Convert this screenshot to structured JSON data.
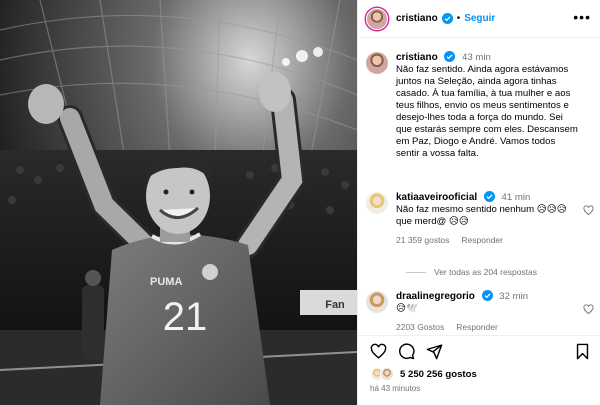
{
  "header": {
    "username": "cristiano",
    "separator": "•",
    "follow_label": "Seguir",
    "more_label": "•••"
  },
  "caption": {
    "username": "cristiano",
    "time": "43 min",
    "text": "Não faz sentido. Ainda agora estávamos juntos na Seleção, ainda agora tinhas casado. À tua família, à tua mulher e aos teus filhos, envio os meus sentimentos e desejo-lhes toda a força do mundo. Sei que estarás sempre com eles. Descansem em Paz, Diogo e André. Vamos todos sentir a vossa falta."
  },
  "comments": [
    {
      "username": "katiaaveirooficial",
      "time": "41 min",
      "text": "Não faz mesmo sentido nenhum 😥😥😥 que merd@ 😥😥",
      "likes": "21 359 gostos",
      "reply_label": "Responder"
    },
    {
      "username": "draalinegregorio",
      "time": "32 min",
      "text": "😥🕊️",
      "likes": "2203 Gostos",
      "reply_label": "Responder"
    }
  ],
  "view_replies_label": "Ver todas as 204 respostas",
  "footer": {
    "likes_count": "5 250 256 gostos",
    "time_ago": "há 43 minutos"
  },
  "photo": {
    "jersey_number": "21",
    "jersey_brand": "PUMA"
  },
  "colors": {
    "link_blue": "#0095f6",
    "verified_blue": "#0095f6",
    "muted_text": "#737373",
    "divider": "#efefef"
  }
}
